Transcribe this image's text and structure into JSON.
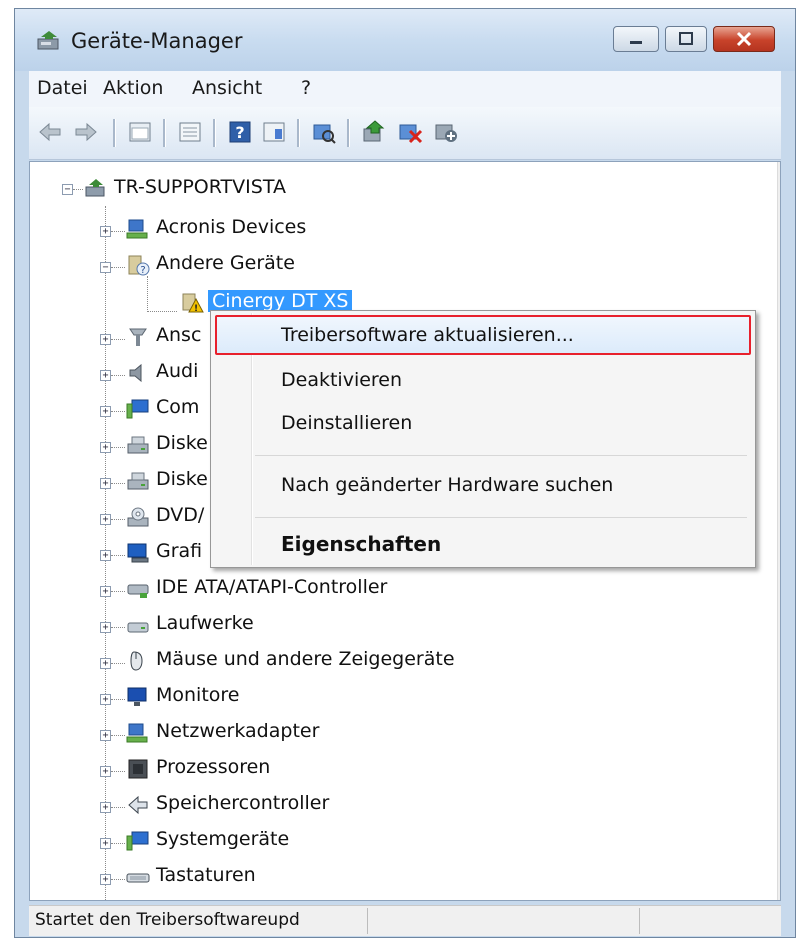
{
  "window": {
    "title": "Geräte-Manager"
  },
  "menu": [
    "Datei",
    "Aktion",
    "Ansicht",
    "?"
  ],
  "toolbar": [
    "back-icon",
    "forward-icon",
    "properties-view-icon",
    "console-icon",
    "help-icon",
    "view-icon",
    "scan-hardware-icon",
    "update-driver-icon",
    "uninstall-icon",
    "disable-icon"
  ],
  "tree": {
    "root": "TR-SUPPORTVISTA",
    "items": [
      {
        "label": "Acronis Devices",
        "icon": "network-device-icon"
      },
      {
        "label": "Andere Geräte",
        "icon": "unknown-device-icon",
        "expanded": true
      },
      {
        "label": "Cinergy DT XS",
        "icon": "warning-device-icon",
        "selected": true,
        "child": true
      },
      {
        "label": "Ansc",
        "icon": "port-icon"
      },
      {
        "label": "Audi",
        "icon": "speaker-icon"
      },
      {
        "label": "Com",
        "icon": "computer-icon"
      },
      {
        "label": "Diske",
        "icon": "drive-icon"
      },
      {
        "label": "Diske",
        "icon": "drive-icon"
      },
      {
        "label": "DVD/",
        "icon": "dvd-icon"
      },
      {
        "label": "Grafi",
        "icon": "display-icon"
      },
      {
        "label": "IDE ATA/ATAPI-Controller",
        "icon": "controller-icon"
      },
      {
        "label": "Laufwerke",
        "icon": "disk-drive-icon"
      },
      {
        "label": "Mäuse und andere Zeigegeräte",
        "icon": "mouse-icon"
      },
      {
        "label": "Monitore",
        "icon": "monitor-icon"
      },
      {
        "label": "Netzwerkadapter",
        "icon": "network-adapter-icon"
      },
      {
        "label": "Prozessoren",
        "icon": "processor-icon"
      },
      {
        "label": "Speichercontroller",
        "icon": "storage-controller-icon"
      },
      {
        "label": "Systemgeräte",
        "icon": "system-device-icon"
      },
      {
        "label": "Tastaturen",
        "icon": "keyboard-icon"
      }
    ]
  },
  "context_menu": {
    "items": [
      {
        "label": "Treibersoftware aktualisieren...",
        "highlighted": true
      },
      {
        "label": "Deaktivieren"
      },
      {
        "label": "Deinstallieren"
      },
      {
        "label": "Nach geänderter Hardware suchen"
      },
      {
        "label": "Eigenschaften",
        "bold": true
      }
    ],
    "highlight_color": "#e8202c"
  },
  "status": {
    "text": "Startet den Treibersoftwareupd"
  },
  "colors": {
    "selection": "#3399ff",
    "close_button": "#c8432a"
  }
}
